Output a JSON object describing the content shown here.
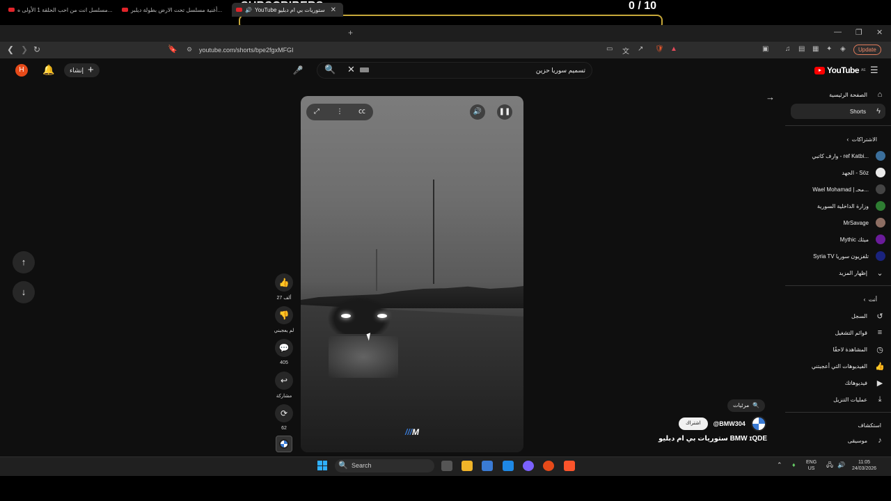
{
  "overlay": {
    "title": "SUBSCRIBERS",
    "count": "0  / 10",
    "accent": "#c8a93a"
  },
  "browser": {
    "tabs": [
      {
        "label": "مسلسل انت من احب الحلقة 1 الأولى ه..."
      },
      {
        "label": "أغنية مسلسل تحت الارض بطولة ديلبر..."
      },
      {
        "label": "YouTube ستوريات بي ام دبليو"
      }
    ],
    "url": "youtube.com/shorts/bpe2fgxMFGI",
    "update_label": "Update"
  },
  "header": {
    "avatar_letter": "H",
    "create_label": "إنشاء",
    "search_value": "تسميم سوريا حزين",
    "logo_text": "YouTube",
    "logo_region": "AE"
  },
  "actions": {
    "like_count": "27 ألف",
    "dislike_label": "لم يعجبني",
    "comment_count": "405",
    "share_label": "مشاركة",
    "remix_count": "62"
  },
  "channel": {
    "search_label": "مرئيات",
    "subscribe_label": "اشتراك",
    "handle": "@BMW304",
    "title": "ستوريات بي ام دبليو BMW ɪQDE"
  },
  "video": {
    "brand_mark": "M"
  },
  "sidebar": {
    "home": "الصفحة الرئيسية",
    "shorts": "Shorts",
    "subscriptions_header": "الاشتراكات",
    "subscriptions": [
      {
        "label": "وارف كاتبي - ref Katbi...",
        "color": "#3b6f9c"
      },
      {
        "label": "الجهد - Söz",
        "color": "#e9e9e9"
      },
      {
        "label": "Wael Mohamad | محـ...",
        "color": "#444"
      },
      {
        "label": "وزارة الداخلية السورية",
        "color": "#2e7d32"
      },
      {
        "label": "MrSavage",
        "color": "#8d6e63"
      },
      {
        "label": "Mythic ميثك",
        "color": "#6a1b9a"
      },
      {
        "label": "Syria TV تلفزيون سوريا",
        "color": "#1a237e"
      }
    ],
    "show_more": "إظهار المزيد",
    "you_header": "أنت",
    "you_items": [
      {
        "label": "السجل",
        "icon": "history-icon"
      },
      {
        "label": "قوائم التشغيل",
        "icon": "playlist-icon"
      },
      {
        "label": "المشاهدة لاحقًا",
        "icon": "watch-later-icon"
      },
      {
        "label": "الفيديوهات التي أعجبتني",
        "icon": "like-icon"
      },
      {
        "label": "فيديوهاتك",
        "icon": "your-videos-icon"
      },
      {
        "label": "عمليات التنزيل",
        "icon": "download-icon"
      }
    ],
    "explore_header": "استكشاف",
    "explore_items": [
      {
        "label": "موسيقى",
        "icon": "music-icon"
      }
    ]
  },
  "taskbar": {
    "search_placeholder": "Search",
    "lang": "ENG",
    "region": "US",
    "time": "11:05",
    "date": "24/03/2026"
  }
}
